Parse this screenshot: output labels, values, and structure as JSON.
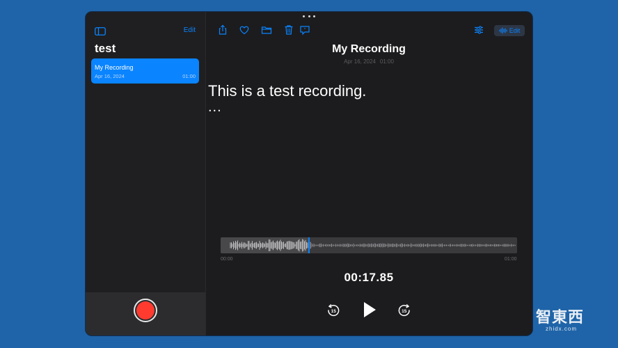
{
  "sidebar": {
    "edit_label": "Edit",
    "title": "test",
    "recordings": [
      {
        "name": "My Recording",
        "date": "Apr 16, 2024",
        "duration": "01:00",
        "selected": true
      }
    ]
  },
  "toolbar": {
    "icons": [
      "share-icon",
      "heart-icon",
      "folder-icon",
      "trash-icon",
      "transcript-icon",
      "sliders-icon"
    ],
    "edit_label": "Edit"
  },
  "recording": {
    "title": "My Recording",
    "date": "Apr 16, 2024",
    "duration": "01:00",
    "transcript": "This is a test recording.",
    "transcript_more": "...",
    "start_time": "00:00",
    "end_time": "01:00",
    "elapsed": "00:17.85",
    "playhead_fraction": 0.2975
  },
  "controls": {
    "skip_back_seconds": "15",
    "skip_forward_seconds": "15"
  },
  "watermark": {
    "text": "智東西",
    "sub": "zhidx.com"
  },
  "colors": {
    "accent": "#0a84ff",
    "record": "#ff3b30",
    "background": "#1c1c1e",
    "desktop": "#1f64a8"
  }
}
